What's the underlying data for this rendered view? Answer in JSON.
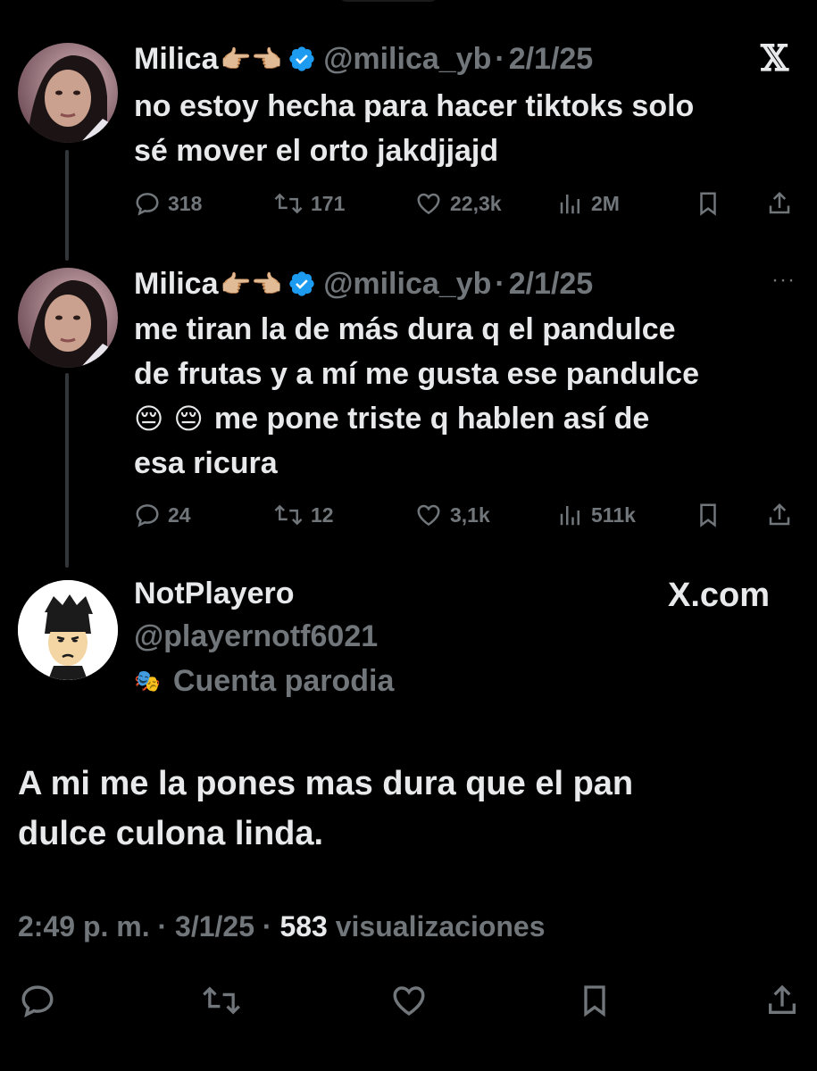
{
  "tweets": [
    {
      "name": "Milica",
      "name_emoji": "👉🏼👈🏼",
      "handle": "@milica_yb",
      "separator": "·",
      "date": "2/1/25",
      "text_line1": "no estoy hecha para hacer tiktoks solo",
      "text_line2": "sé mover el orto jakdjjajd",
      "replies": "318",
      "retweets": "171",
      "likes": "22,3k",
      "views": "2M",
      "corner_icon": "x-logo-icon"
    },
    {
      "name": "Milica",
      "name_emoji": "👉🏼👈🏼",
      "handle": "@milica_yb",
      "separator": "·",
      "date": "2/1/25",
      "text_line1": "me tiran la de más dura q el pandulce",
      "text_line2": "de frutas y a mí me gusta ese pandulce",
      "text_line3_emoji": "😔 😔",
      "text_line3": "me pone triste q hablen así de",
      "text_line4": "esa ricura",
      "replies": "24",
      "retweets": "12",
      "likes": "3,1k",
      "views": "511k",
      "corner_icon": "more-icon",
      "more_label": "···"
    }
  ],
  "reply": {
    "name": "NotPlayero",
    "handle": "@playernotf6021",
    "parody_icon": "🎭",
    "parody_label": "Cuenta parodia",
    "brand": "X.com",
    "text_line1": "A mi me la pones mas dura que el pan",
    "text_line2": "dulce culona linda.",
    "time": "2:49 p. m.",
    "separator": "·",
    "date": "3/1/25",
    "views_count": "583",
    "views_label": "visualizaciones"
  },
  "colors": {
    "background": "#000000",
    "text": "#e7e9ea",
    "muted": "#71767b",
    "verified": "#1d9bf0"
  }
}
